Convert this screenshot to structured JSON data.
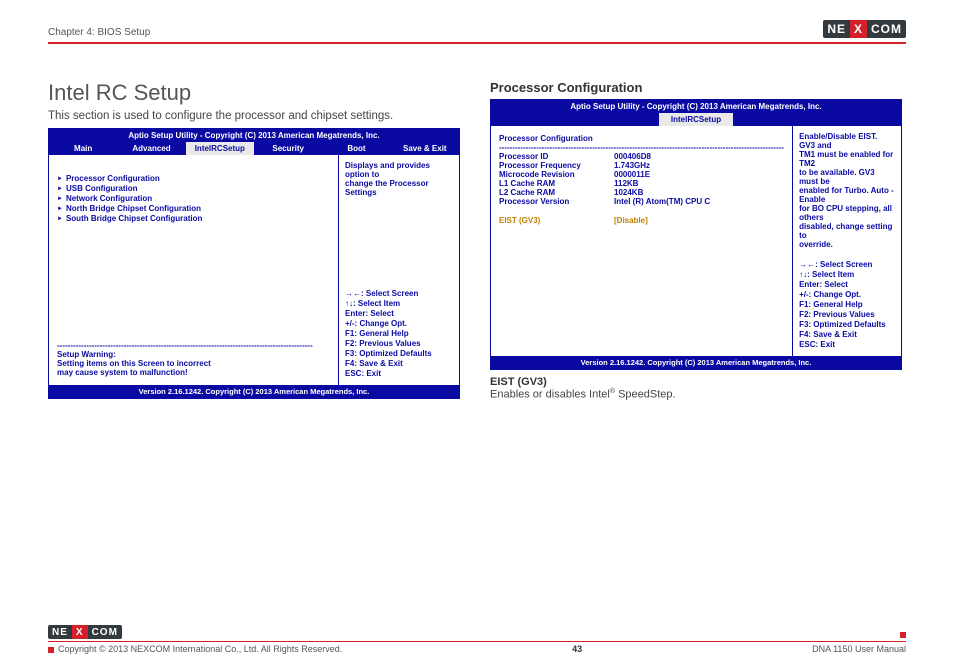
{
  "header": {
    "chapter": "Chapter 4: BIOS Setup",
    "logo": {
      "part1": "NE",
      "part2": "X",
      "part3": "COM"
    }
  },
  "left": {
    "title": "Intel RC Setup",
    "intro": "This section is used to configure the processor and chipset settings.",
    "bios": {
      "title": "Aptio Setup Utility - Copyright (C) 2013 American Megatrends, Inc.",
      "tabs": [
        "Main",
        "Advanced",
        "IntelRCSetup",
        "Security",
        "Boot",
        "Save & Exit"
      ],
      "active_tab": 2,
      "items": [
        "Processor Configuration",
        "USB Configuration",
        "Network Configuration",
        "North Bridge Chipset Configuration",
        "South Bridge Chipset Configuration"
      ],
      "warn_divider": "------------------------------------------------------------------------------------------------",
      "warn_heading": "Setup Warning:",
      "warn_line1": "Setting items on this Screen to incorrect",
      "warn_line2": "may cause system to malfunction!",
      "help_text1": "Displays and provides option to",
      "help_text2": "change the Processor Settings",
      "keys": [
        "→←: Select Screen",
        "↑↓: Select Item",
        "Enter: Select",
        "+/-: Change Opt.",
        "F1: General Help",
        "F2: Previous Values",
        "F3: Optimized Defaults",
        "F4: Save & Exit",
        "ESC: Exit"
      ],
      "footer": "Version 2.16.1242. Copyright (C) 2013 American Megatrends, Inc."
    }
  },
  "right": {
    "heading": "Processor Configuration",
    "bios": {
      "title": "Aptio Setup Utility - Copyright (C) 2013 American Megatrends, Inc.",
      "tab": "IntelRCSetup",
      "groupheader": "Processor Configuration",
      "divider": "-----------------------------------------------------------------------------------------------------------",
      "rows": [
        {
          "k": "Processor ID",
          "v": "000406D8"
        },
        {
          "k": "Processor Frequency",
          "v": "1.743GHz"
        },
        {
          "k": "Microcode Revision",
          "v": "0000011E"
        },
        {
          "k": "L1 Cache RAM",
          "v": "112KB"
        },
        {
          "k": "L2 Cache RAM",
          "v": "1024KB"
        },
        {
          "k": "Processor Version",
          "v": "Intel (R) Atom(TM) CPU C"
        }
      ],
      "opt_key": "EIST (GV3)",
      "opt_val": "[Disable]",
      "help_lines": [
        "Enable/Disable EIST. GV3 and",
        "TM1 must be enabled for TM2",
        "to be available. GV3 must be",
        "enabled for Turbo. Auto - Enable",
        "for BO CPU stepping, all others",
        "disabled, change setting to",
        "override."
      ],
      "keys": [
        "→←: Select Screen",
        "↑↓: Select Item",
        "Enter: Select",
        "+/-: Change Opt.",
        "F1: General Help",
        "F2: Previous Values",
        "F3: Optimized Defaults",
        "F4: Save & Exit",
        "ESC: Exit"
      ],
      "footer": "Version 2.16.1242. Copyright (C) 2013 American Megatrends, Inc."
    },
    "opt_label": "EIST (GV3)",
    "opt_desc_a": "Enables or disables Intel",
    "opt_desc_reg": "®",
    "opt_desc_b": " SpeedStep."
  },
  "footer": {
    "logo": {
      "part1": "NE",
      "part2": "X",
      "part3": "COM"
    },
    "copyright": "Copyright © 2013 NEXCOM International Co., Ltd. All Rights Reserved.",
    "page": "43",
    "docname": "DNA 1150 User Manual"
  }
}
